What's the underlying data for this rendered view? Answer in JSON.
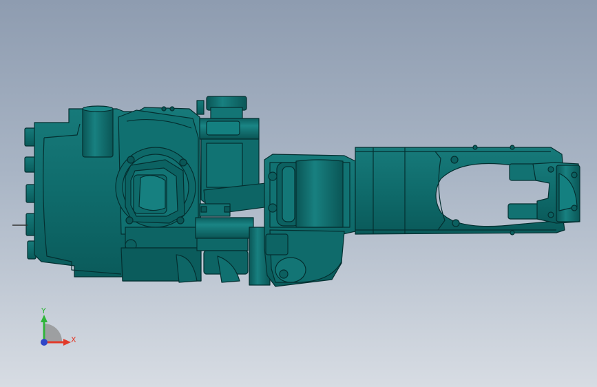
{
  "viewport": {
    "background_top": "#8e9cb0",
    "background_bottom": "#d7dce3"
  },
  "model": {
    "color": "#0f6b6b",
    "edge_color": "#042f30"
  },
  "triad": {
    "x_label": "X",
    "y_label": "Y",
    "x_color": "#e23a2a",
    "y_color": "#2fb53a",
    "z_color": "#2f46c8"
  }
}
